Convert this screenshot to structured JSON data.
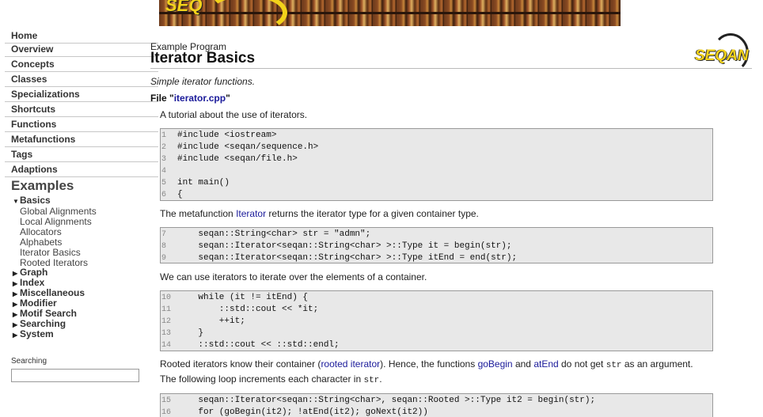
{
  "banner": {
    "logo_text": "SEQ"
  },
  "sidebar": {
    "nav": [
      "Home",
      "Overview",
      "Concepts",
      "Classes",
      "Specializations",
      "Shortcuts",
      "Functions",
      "Metafunctions",
      "Tags",
      "Adaptions"
    ],
    "examples_heading": "Examples",
    "basics_label": "Basics",
    "basics_children": [
      "Global Alignments",
      "Local Alignments",
      "Allocators",
      "Alphabets",
      "Iterator Basics",
      "Rooted Iterators"
    ],
    "collapsed_groups": [
      "Graph",
      "Index",
      "Miscellaneous",
      "Modifier",
      "Motif Search",
      "Searching",
      "System"
    ],
    "search_label": "Searching",
    "search_value": ""
  },
  "main": {
    "kicker": "Example Program",
    "title": "Iterator Basics",
    "logo_text": "SEQAN",
    "subtitle": "Simple iterator functions.",
    "file_prefix": "File \"",
    "file_name": "iterator.cpp",
    "file_suffix": "\"",
    "intro": "A tutorial about the use of iterators.",
    "code1": [
      {
        "n": "1",
        "t": "#include <iostream>"
      },
      {
        "n": "2",
        "t": "#include <seqan/sequence.h>"
      },
      {
        "n": "3",
        "t": "#include <seqan/file.h>"
      },
      {
        "n": "4",
        "t": ""
      },
      {
        "n": "5",
        "t": "int main()"
      },
      {
        "n": "6",
        "t": "{"
      }
    ],
    "p2_a": "The metafunction ",
    "p2_link": "Iterator",
    "p2_b": " returns the iterator type for a given container type.",
    "code2": [
      {
        "n": "7",
        "t": "    seqan::String<char> str = \"admn\";"
      },
      {
        "n": "8",
        "t": "    seqan::Iterator<seqan::String<char> >::Type it = begin(str);"
      },
      {
        "n": "9",
        "t": "    seqan::Iterator<seqan::String<char> >::Type itEnd = end(str);"
      }
    ],
    "p3": "We can use iterators to iterate over the elements of a container.",
    "code3": [
      {
        "n": "10",
        "t": "    while (it != itEnd) {"
      },
      {
        "n": "11",
        "t": "        ::std::cout << *it;"
      },
      {
        "n": "12",
        "t": "        ++it;"
      },
      {
        "n": "13",
        "t": "    }"
      },
      {
        "n": "14",
        "t": "    ::std::cout << ::std::endl;"
      }
    ],
    "p4_a": "Rooted iterators know their container (",
    "p4_link1": "rooted iterator",
    "p4_b": "). Hence, the functions ",
    "p4_link2": "goBegin",
    "p4_c": " and ",
    "p4_link3": "atEnd",
    "p4_d": " do not get ",
    "p4_code1": "str",
    "p4_e": " as an argument. The following loop increments each character in ",
    "p4_code2": "str",
    "p4_f": ".",
    "code4": [
      {
        "n": "15",
        "t": "    seqan::Iterator<seqan::String<char>, seqan::Rooted >::Type it2 = begin(str);"
      },
      {
        "n": "16",
        "t": "    for (goBegin(it2); !atEnd(it2); goNext(it2))"
      }
    ]
  }
}
